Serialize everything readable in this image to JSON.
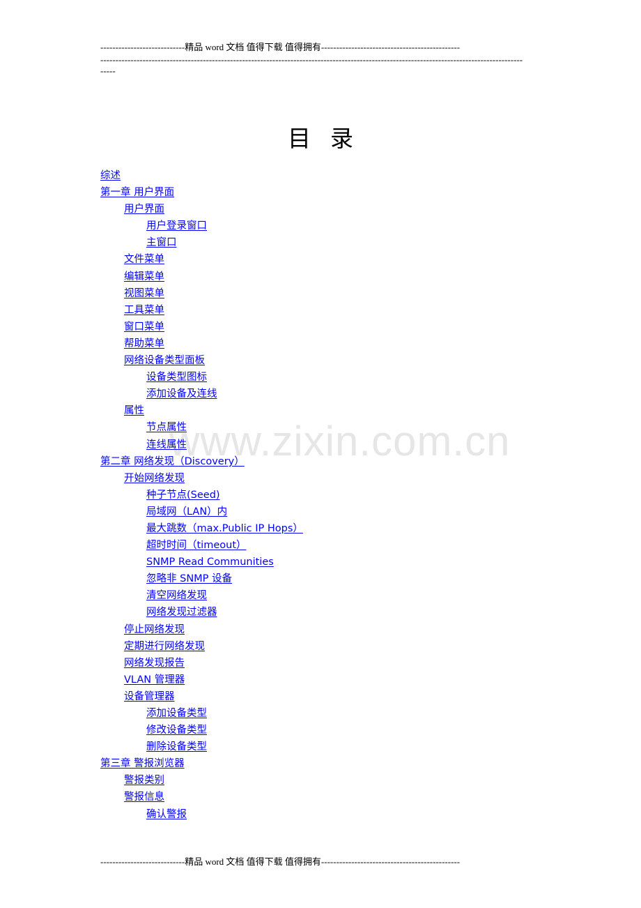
{
  "header": {
    "line1": "----------------------------精品 word 文档  值得下载  值得拥有----------------------------------------------",
    "line2": "--------------------------------------------------------------------------------------------------------------------------------------------",
    "line3": "-----"
  },
  "footer": {
    "line": "----------------------------精品 word 文档  值得下载  值得拥有----------------------------------------------"
  },
  "title": "目录",
  "watermark": "www.zixin.com.cn",
  "colors": {
    "link": "#0000ff",
    "watermark": "#e6e6e6",
    "text": "#000000"
  },
  "toc": [
    {
      "level": 1,
      "label": "综述"
    },
    {
      "level": 1,
      "label": "第一章 用户界面"
    },
    {
      "level": 2,
      "label": "用户界面"
    },
    {
      "level": 3,
      "label": "用户登录窗口"
    },
    {
      "level": 3,
      "label": "主窗口"
    },
    {
      "level": 2,
      "label": "文件菜单"
    },
    {
      "level": 2,
      "label": "编辑菜单"
    },
    {
      "level": 2,
      "label": "视图菜单"
    },
    {
      "level": 2,
      "label": "工具菜单"
    },
    {
      "level": 2,
      "label": "窗口菜单"
    },
    {
      "level": 2,
      "label": "帮助菜单"
    },
    {
      "level": 2,
      "label": "网络设备类型面板"
    },
    {
      "level": 3,
      "label": "设备类型图标"
    },
    {
      "level": 3,
      "label": "添加设备及连线"
    },
    {
      "level": 2,
      "label": "属性"
    },
    {
      "level": 3,
      "label": "节点属性"
    },
    {
      "level": 3,
      "label": "连线属性"
    },
    {
      "level": 1,
      "label": "第二章 网络发现（Discovery） "
    },
    {
      "level": 2,
      "label": "开始网络发现"
    },
    {
      "level": 3,
      "label": "种子节点(Seed)"
    },
    {
      "level": 3,
      "label": "局域网（LAN）内"
    },
    {
      "level": 3,
      "label": "最大跳数（max.Public IP Hops） "
    },
    {
      "level": 3,
      "label": "超时时间（timeout） "
    },
    {
      "level": 3,
      "label": "SNMP Read Communities"
    },
    {
      "level": 3,
      "label": "忽略非 SNMP 设备"
    },
    {
      "level": 3,
      "label": "清空网络发现"
    },
    {
      "level": 3,
      "label": "网络发现过滤器"
    },
    {
      "level": 2,
      "label": "停止网络发现"
    },
    {
      "level": 2,
      "label": "定期进行网络发现"
    },
    {
      "level": 2,
      "label": "网络发现报告"
    },
    {
      "level": 2,
      "label": "VLAN 管理器"
    },
    {
      "level": 2,
      "label": "设备管理器"
    },
    {
      "level": 3,
      "label": "添加设备类型"
    },
    {
      "level": 3,
      "label": "修改设备类型"
    },
    {
      "level": 3,
      "label": "删除设备类型"
    },
    {
      "level": 1,
      "label": "第三章 警报浏览器"
    },
    {
      "level": 2,
      "label": "警报类别"
    },
    {
      "level": 2,
      "label": "警报信息"
    },
    {
      "level": 3,
      "label": "确认警报"
    }
  ]
}
